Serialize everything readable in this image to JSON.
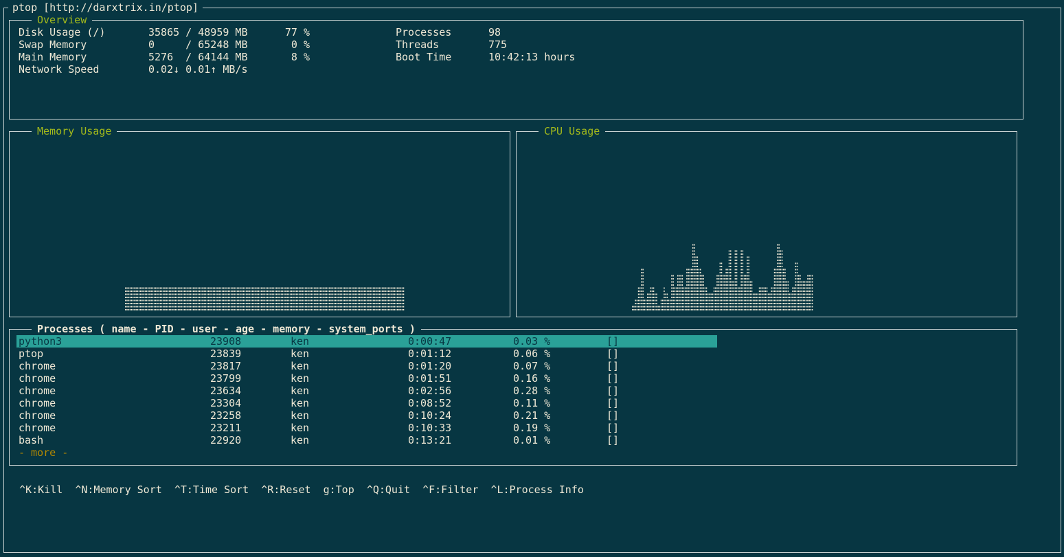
{
  "window": {
    "title": "ptop [http://darxtrix.in/ptop]"
  },
  "overview": {
    "title": "Overview",
    "rows": [
      {
        "label": "Disk Usage (/)",
        "value": "35865 / 48959 MB",
        "percent": "77 %"
      },
      {
        "label": "Swap Memory",
        "value": "0     / 65248 MB",
        "percent": "0 %"
      },
      {
        "label": "Main Memory",
        "value": "5276  / 64144 MB",
        "percent": "8 %"
      },
      {
        "label": "Network Speed",
        "value": "0.02↓ 0.01↑ MB/s",
        "percent": ""
      }
    ],
    "stats": [
      {
        "label": "Processes",
        "value": "98"
      },
      {
        "label": "Threads",
        "value": "775"
      },
      {
        "label": "Boot Time",
        "value": "10:42:13 hours"
      }
    ]
  },
  "memory_chart": {
    "title": "Memory Usage",
    "values": [
      0,
      0,
      0,
      0,
      0,
      0,
      0,
      0,
      0,
      0,
      0,
      0,
      0,
      0,
      0,
      0,
      0,
      0,
      0,
      0,
      0,
      0,
      0,
      0,
      0,
      0,
      0,
      0,
      0,
      0,
      0,
      0,
      0,
      0,
      0,
      0,
      0,
      0,
      0,
      0,
      0,
      0,
      0,
      0,
      0,
      0,
      0,
      0,
      0,
      0,
      0,
      0,
      0,
      0,
      0,
      0,
      0,
      0,
      0,
      0,
      0,
      0,
      0,
      0,
      0,
      0,
      0,
      0,
      0,
      0,
      0,
      0,
      0,
      0,
      0,
      0,
      0,
      0,
      0,
      0,
      0,
      0,
      0,
      0,
      8,
      8,
      8,
      8,
      8,
      8,
      8,
      8,
      8,
      8,
      8,
      8,
      8,
      8,
      8,
      8,
      8,
      8,
      8,
      8,
      8,
      8,
      8,
      8,
      8,
      8,
      8,
      8,
      8,
      8,
      8,
      8,
      8,
      8,
      8,
      8,
      8,
      8,
      8,
      8,
      8,
      8,
      8,
      8,
      8,
      8,
      8,
      8,
      8,
      8,
      8,
      8,
      8,
      8,
      8,
      8,
      8,
      8,
      8,
      8,
      8,
      8,
      8,
      8,
      8,
      8,
      8,
      8,
      8,
      8,
      8,
      8,
      8,
      8,
      8,
      8,
      8,
      8,
      8,
      8,
      8,
      8,
      8,
      8,
      8,
      8,
      8,
      8,
      8,
      8,
      8,
      8,
      8,
      8,
      8,
      8,
      8,
      8,
      8,
      8,
      8,
      8,
      8,
      8,
      8,
      8,
      8,
      8,
      8,
      8,
      8,
      8,
      8,
      8,
      8,
      8,
      8,
      8,
      8,
      8,
      8,
      8,
      8,
      8,
      8,
      8,
      8,
      8,
      8,
      8,
      8,
      8,
      8,
      8,
      8,
      8,
      8,
      8,
      8,
      8,
      8,
      8,
      8,
      8,
      8,
      8,
      8,
      8,
      8,
      8,
      8,
      8,
      8,
      8,
      8,
      8,
      8,
      8,
      8,
      8,
      8,
      8,
      8,
      8,
      8,
      8,
      8,
      8,
      8,
      8,
      8,
      8,
      8,
      8,
      8,
      8,
      8,
      8,
      8,
      8,
      8,
      8,
      8,
      8,
      8
    ],
    "max": 100
  },
  "cpu_chart": {
    "title": "CPU Usage",
    "values": [
      0,
      0,
      0,
      0,
      0,
      0,
      0,
      0,
      0,
      0,
      0,
      0,
      0,
      0,
      0,
      0,
      0,
      0,
      0,
      0,
      0,
      0,
      0,
      0,
      0,
      0,
      0,
      0,
      0,
      0,
      0,
      0,
      0,
      0,
      0,
      0,
      0,
      0,
      0,
      0,
      0,
      0,
      0,
      0,
      0,
      0,
      0,
      0,
      0,
      0,
      0,
      0,
      0,
      0,
      0,
      0,
      0,
      0,
      0,
      0,
      0,
      0,
      0,
      0,
      0,
      0,
      0,
      0,
      0,
      0,
      0,
      0,
      0,
      0,
      0,
      0,
      0,
      0,
      0,
      0,
      0,
      0,
      0,
      0,
      2,
      2,
      4,
      4,
      8,
      8,
      14,
      14,
      4,
      4,
      6,
      6,
      8,
      8,
      8,
      6,
      6,
      2,
      2,
      4,
      4,
      8,
      6,
      6,
      4,
      4,
      12,
      12,
      8,
      8,
      12,
      12,
      12,
      12,
      8,
      8,
      14,
      14,
      14,
      14,
      22,
      22,
      18,
      18,
      14,
      14,
      12,
      12,
      8,
      8,
      6,
      6,
      6,
      6,
      8,
      8,
      12,
      12,
      16,
      16,
      12,
      12,
      14,
      14,
      20,
      20,
      10,
      10,
      20,
      20,
      8,
      8,
      20,
      20,
      12,
      12,
      18,
      18,
      10,
      10,
      6,
      6,
      6,
      6,
      8,
      8,
      8,
      8,
      8,
      8,
      6,
      6,
      8,
      8,
      14,
      14,
      22,
      22,
      20,
      20,
      14,
      14,
      10,
      10,
      6,
      6,
      8,
      8,
      16,
      16,
      12,
      12,
      10,
      10,
      10,
      10,
      12,
      12,
      12,
      12
    ]
  },
  "processes": {
    "title": "Processes ( name - PID - user - age - memory - system_ports )",
    "rows": [
      {
        "name": "python3",
        "pid": "23908",
        "user": "ken",
        "age": "0:00:47",
        "memory": "0.03 %",
        "ports": "[]"
      },
      {
        "name": "ptop",
        "pid": "23839",
        "user": "ken",
        "age": "0:01:12",
        "memory": "0.06 %",
        "ports": "[]"
      },
      {
        "name": "chrome",
        "pid": "23817",
        "user": "ken",
        "age": "0:01:20",
        "memory": "0.07 %",
        "ports": "[]"
      },
      {
        "name": "chrome",
        "pid": "23799",
        "user": "ken",
        "age": "0:01:51",
        "memory": "0.16 %",
        "ports": "[]"
      },
      {
        "name": "chrome",
        "pid": "23634",
        "user": "ken",
        "age": "0:02:56",
        "memory": "0.28 %",
        "ports": "[]"
      },
      {
        "name": "chrome",
        "pid": "23304",
        "user": "ken",
        "age": "0:08:52",
        "memory": "0.11 %",
        "ports": "[]"
      },
      {
        "name": "chrome",
        "pid": "23258",
        "user": "ken",
        "age": "0:10:24",
        "memory": "0.21 %",
        "ports": "[]"
      },
      {
        "name": "chrome",
        "pid": "23211",
        "user": "ken",
        "age": "0:10:33",
        "memory": "0.19 %",
        "ports": "[]"
      },
      {
        "name": "bash",
        "pid": "22920",
        "user": "ken",
        "age": "0:13:21",
        "memory": "0.01 %",
        "ports": "[]"
      }
    ],
    "more_label": "- more -"
  },
  "shortcuts": [
    "^K:Kill",
    "^N:Memory Sort",
    "^T:Time Sort",
    "^R:Reset",
    "g:Top",
    "^Q:Quit",
    "^F:Filter",
    "^L:Process Info"
  ],
  "colors": {
    "background": "#073642",
    "accent_title": "#a2b91b",
    "selection": "#2aa198",
    "more": "#b58900"
  }
}
